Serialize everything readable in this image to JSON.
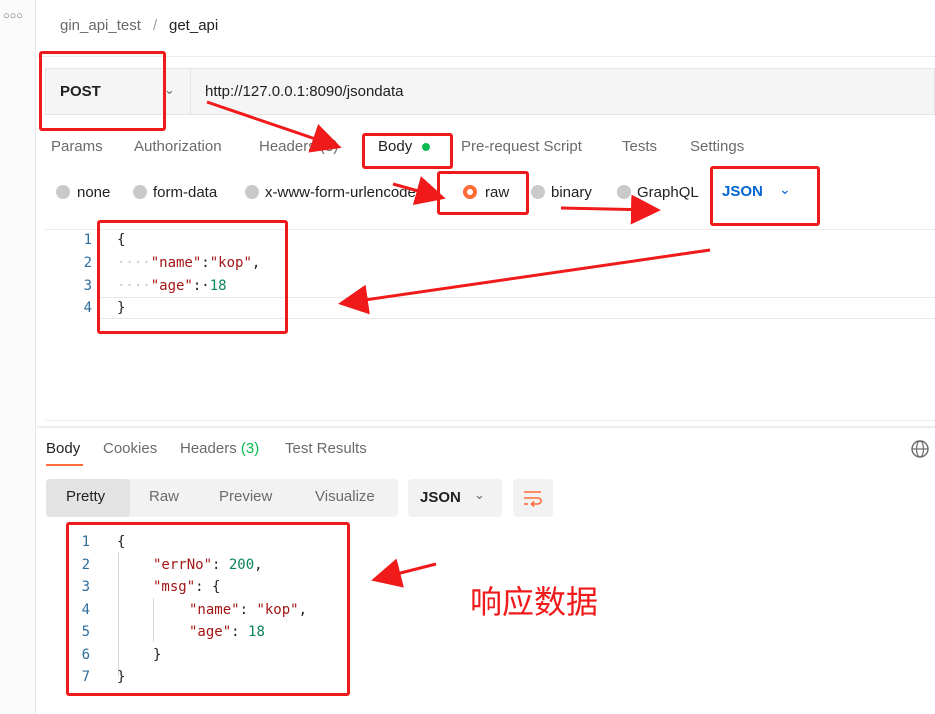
{
  "breadcrumb": {
    "collection": "gin_api_test",
    "separator": "/",
    "request": "get_api"
  },
  "request": {
    "method": "POST",
    "url": "http://127.0.0.1:8090/jsondata",
    "tabs": [
      "Params",
      "Authorization",
      "Headers (8)",
      "Body",
      "Pre-request Script",
      "Tests",
      "Settings"
    ],
    "active_tab": "Body",
    "body_types": [
      "none",
      "form-data",
      "x-www-form-urlencoded",
      "raw",
      "binary",
      "GraphQL"
    ],
    "selected_body_type": "raw",
    "raw_format": "JSON",
    "body_code": [
      {
        "n": "1",
        "text": "{"
      },
      {
        "n": "2",
        "ws": "····",
        "key": "\"name\"",
        "sep": ":",
        "val": "\"kop\"",
        "end": ","
      },
      {
        "n": "3",
        "ws": "····",
        "key": "\"age\"",
        "sep": ":·",
        "val": "18",
        "end": ""
      },
      {
        "n": "4",
        "text": "}"
      }
    ]
  },
  "response": {
    "tabs": [
      "Body",
      "Cookies",
      "Headers (3)",
      "Test Results"
    ],
    "headers_label": "Headers",
    "headers_count": "(3)",
    "views": [
      "Pretty",
      "Raw",
      "Preview",
      "Visualize"
    ],
    "active_view": "Pretty",
    "format": "JSON",
    "code": [
      {
        "n": "1",
        "text": "{"
      },
      {
        "n": "2",
        "key": "\"errNo\"",
        "sep": ": ",
        "val": "200",
        "end": ","
      },
      {
        "n": "3",
        "key": "\"msg\"",
        "sep": ": {",
        "val": "",
        "end": ""
      },
      {
        "n": "4",
        "key": "\"name\"",
        "sep": ": ",
        "val": "\"kop\"",
        "end": ","
      },
      {
        "n": "5",
        "key": "\"age\"",
        "sep": ": ",
        "val": "18",
        "end": ""
      },
      {
        "n": "6",
        "text": "}"
      },
      {
        "n": "7",
        "text": "}"
      }
    ]
  },
  "annotation": "响应数据",
  "colors": {
    "annotation_red": "#f01a1a",
    "active_green": "#0cbb52",
    "radio_orange": "#ff6c37",
    "json_blue": "#0265d2"
  },
  "icons": [
    "more-icon",
    "chevron-down-icon",
    "globe-icon",
    "wrap-icon"
  ]
}
